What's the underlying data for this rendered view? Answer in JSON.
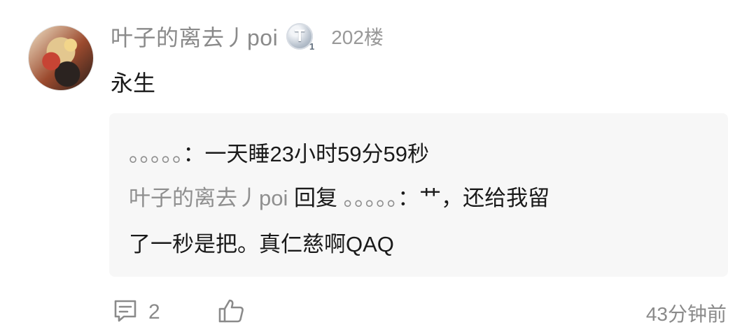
{
  "post": {
    "username": "叶子的离去丿poi",
    "badge_letter": "T",
    "badge_level": "1",
    "floor": "202楼",
    "content": "永生"
  },
  "reply": {
    "line1_user": "。。。。。",
    "line1_colon": "：",
    "line1_text": "一天睡23小时59分59秒",
    "line2_user": "叶子的离去丿poi",
    "line2_action": " 回复 ",
    "line2_target": "。。。。。",
    "line2_text": "：艹，还给我留",
    "line3_text": "了一秒是把。真仁慈啊QAQ"
  },
  "actions": {
    "comment_count": "2",
    "time": "43分钟前"
  },
  "icons": {
    "comment": "comment-icon",
    "like": "thumbs-up-icon"
  }
}
